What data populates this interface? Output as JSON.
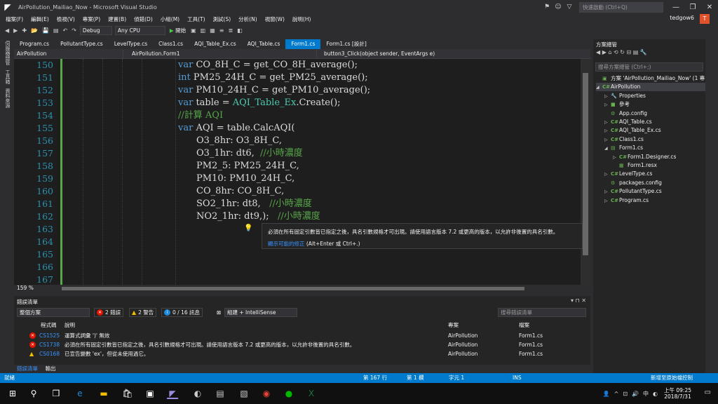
{
  "window": {
    "title": "AirPollution_Mailiao_Now - Microsoft Visual Studio",
    "quick_launch": "快速啟動 (Ctrl+Q)",
    "user": "tedgow6",
    "avatar_letter": "T"
  },
  "menu": [
    "檔案(F)",
    "編輯(E)",
    "檢視(V)",
    "專案(P)",
    "建置(B)",
    "偵錯(D)",
    "小組(M)",
    "工具(T)",
    "測試(S)",
    "分析(N)",
    "視窗(W)",
    "說明(H)"
  ],
  "toolbar": {
    "config": "Debug",
    "platform": "Any CPU",
    "start_label": "開始"
  },
  "left_strip": [
    "伺服器總管",
    "工具箱",
    "資料來源"
  ],
  "tabs": [
    {
      "label": "Program.cs",
      "active": false
    },
    {
      "label": "PollutantType.cs",
      "active": false
    },
    {
      "label": "LevelType.cs",
      "active": false
    },
    {
      "label": "Class1.cs",
      "active": false
    },
    {
      "label": "AQI_Table_Ex.cs",
      "active": false
    },
    {
      "label": "AQI_Table.cs",
      "active": false
    },
    {
      "label": "Form1.cs",
      "active": true
    },
    {
      "label": "Form1.cs [設計]",
      "active": false
    }
  ],
  "navbar": {
    "project": "AirPollution",
    "class": "AirPollution.Form1",
    "member": "button3_Click(object sender, EventArgs e)"
  },
  "code_lines": [
    {
      "num": "150",
      "indent": 0,
      "parts": [
        [
          "kw",
          "var"
        ],
        [
          "",
          " CO_8H_C = get_CO_8H_average();"
        ]
      ]
    },
    {
      "num": "151",
      "indent": 0,
      "parts": [
        [
          "kw",
          "int"
        ],
        [
          "",
          " PM25_24H_C = get_PM25_average();"
        ]
      ]
    },
    {
      "num": "152",
      "indent": 0,
      "parts": [
        [
          "kw",
          "var"
        ],
        [
          "",
          " PM10_24H_C = get_PM10_average();"
        ]
      ]
    },
    {
      "num": "153",
      "indent": 0,
      "parts": [
        [
          "kw",
          "var"
        ],
        [
          "",
          " table = "
        ],
        [
          "ty",
          "AQI_Table_Ex"
        ],
        [
          "",
          ".Create();"
        ]
      ]
    },
    {
      "num": "154",
      "indent": 0,
      "parts": [
        [
          "cm",
          "//計算 AQI"
        ]
      ]
    },
    {
      "num": "155",
      "indent": 0,
      "parts": [
        [
          "kw",
          "var"
        ],
        [
          "",
          " AQI = table.CalcAQI("
        ]
      ]
    },
    {
      "num": "156",
      "indent": 1,
      "parts": [
        [
          "",
          "O3_8hr: O3_8H_C,"
        ]
      ]
    },
    {
      "num": "157",
      "indent": 1,
      "parts": [
        [
          "",
          "O3_1hr: dt6,  "
        ],
        [
          "cm",
          "//小時濃度"
        ]
      ]
    },
    {
      "num": "158",
      "indent": 1,
      "parts": [
        [
          "",
          "PM2_5: PM25_24H_C,"
        ]
      ]
    },
    {
      "num": "159",
      "indent": 1,
      "parts": [
        [
          "",
          "PM10: PM10_24H_C,"
        ]
      ]
    },
    {
      "num": "160",
      "indent": 1,
      "parts": [
        [
          "",
          "CO_8hr: CO_8H_C,"
        ]
      ]
    },
    {
      "num": "161",
      "indent": 1,
      "parts": [
        [
          "",
          "SO2_1hr: dt8,   "
        ],
        [
          "cm",
          "//小時濃度"
        ]
      ]
    },
    {
      "num": "162",
      "indent": 1,
      "parts": [
        [
          "",
          "NO2_1hr: dt9,);   "
        ],
        [
          "cm",
          "//小時濃度"
        ]
      ]
    },
    {
      "num": "163",
      "indent": 0,
      "parts": []
    },
    {
      "num": "164",
      "indent": 0,
      "parts": []
    },
    {
      "num": "165",
      "indent": 0,
      "parts": []
    },
    {
      "num": "166",
      "indent": 0,
      "parts": []
    },
    {
      "num": "167",
      "indent": 0,
      "parts": []
    }
  ],
  "tooltip": {
    "message": "必須在所有固定引數皆已指定之後，具名引數規格才可出現。請使用語言版本 7.2 或更高的版本，以允許非後置的具名引數。",
    "link": "顯示可能的修正",
    "shortcut": " (Alt+Enter 或 Ctrl+.)"
  },
  "zoom": "159 %",
  "error_list": {
    "title": "錯誤清單",
    "scope": "整個方案",
    "errors_btn": "2 錯誤",
    "warnings_btn": "2 警告",
    "messages_btn": "0 / 16 訊息",
    "build_filter": "組建 + IntelliSense",
    "search_placeholder": "搜尋錯誤清單",
    "headers": {
      "code": "程式碼",
      "desc": "說明",
      "project": "專案",
      "file": "檔案"
    },
    "rows": [
      {
        "type": "error",
        "code": "CS1525",
        "desc": "運算式詞彙 ')' 無效",
        "project": "AirPollution",
        "file": "Form1.cs"
      },
      {
        "type": "error",
        "code": "CS1738",
        "desc": "必須在所有固定引數皆已指定之後，具名引數規格才可出現。請使用語言版本 7.2 或更高的版本，以允許非後置的具名引數。",
        "project": "AirPollution",
        "file": "Form1.cs"
      },
      {
        "type": "warning",
        "code": "CS0168",
        "desc": "已宣告變數 'ex'，但從未使用過它。",
        "project": "AirPollution",
        "file": "Form1.cs"
      }
    ],
    "bottom_tabs": [
      "錯誤清單",
      "輸出"
    ]
  },
  "solution": {
    "title": "方案總管",
    "search_placeholder": "搜尋方案總管 (Ctrl+;)",
    "items": [
      {
        "label": "方案 'AirPollution_Mailiao_Now' (1 專",
        "level": 0,
        "arrow": "",
        "icon": "▣",
        "selected": false
      },
      {
        "label": "AirPollution",
        "level": 0,
        "arrow": "◢",
        "icon": "C#",
        "selected": true
      },
      {
        "label": "Properties",
        "level": 1,
        "arrow": "▷",
        "icon": "🔧",
        "selected": false
      },
      {
        "label": "參考",
        "level": 1,
        "arrow": "▷",
        "icon": "■",
        "selected": false
      },
      {
        "label": "App.config",
        "level": 1,
        "arrow": "",
        "icon": "⚙",
        "selected": false
      },
      {
        "label": "AQI_Table.cs",
        "level": 1,
        "arrow": "▷",
        "icon": "C#",
        "selected": false
      },
      {
        "label": "AQI_Table_Ex.cs",
        "level": 1,
        "arrow": "▷",
        "icon": "C#",
        "selected": false
      },
      {
        "label": "Class1.cs",
        "level": 1,
        "arrow": "▷",
        "icon": "C#",
        "selected": false
      },
      {
        "label": "Form1.cs",
        "level": 1,
        "arrow": "◢",
        "icon": "▤",
        "selected": false
      },
      {
        "label": "Form1.Designer.cs",
        "level": 2,
        "arrow": "▷",
        "icon": "C#",
        "selected": false
      },
      {
        "label": "Form1.resx",
        "level": 2,
        "arrow": "",
        "icon": "▦",
        "selected": false
      },
      {
        "label": "LevelType.cs",
        "level": 1,
        "arrow": "▷",
        "icon": "C#",
        "selected": false
      },
      {
        "label": "packages.config",
        "level": 1,
        "arrow": "",
        "icon": "⚙",
        "selected": false
      },
      {
        "label": "PollutantType.cs",
        "level": 1,
        "arrow": "▷",
        "icon": "C#",
        "selected": false
      },
      {
        "label": "Program.cs",
        "level": 1,
        "arrow": "▷",
        "icon": "C#",
        "selected": false
      }
    ]
  },
  "status": {
    "ready": "就緒",
    "line": "第 167 行",
    "col": "第 1 欄",
    "char": "字元 1",
    "mode": "INS",
    "source_control": "新增至原始檔控制"
  },
  "taskbar": {
    "time": "上午 09:25",
    "date": "2018/7/31"
  },
  "colors": {
    "accent": "#007acc",
    "editor_bg": "#1e1e1e",
    "keyword": "#569cd6",
    "type": "#4ec9b0",
    "comment": "#57a64a"
  }
}
